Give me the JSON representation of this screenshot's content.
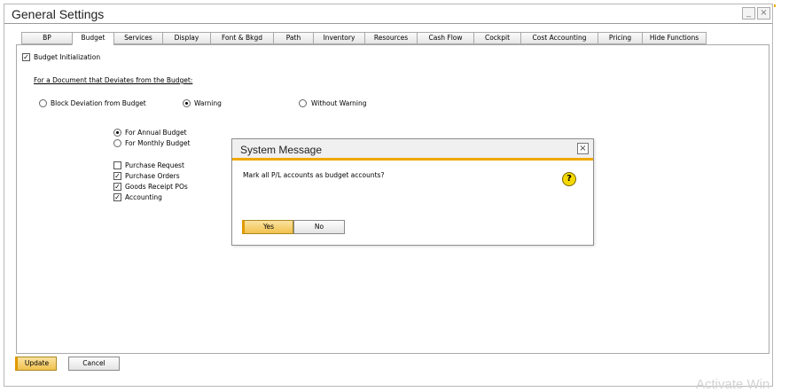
{
  "window": {
    "title": "General Settings",
    "minimize": "_",
    "close": "×"
  },
  "tabs": [
    {
      "label": "BP",
      "active": false
    },
    {
      "label": "Budget",
      "active": true
    },
    {
      "label": "Services",
      "active": false
    },
    {
      "label": "Display",
      "active": false
    },
    {
      "label": "Font & Bkgd",
      "active": false
    },
    {
      "label": "Path",
      "active": false
    },
    {
      "label": "Inventory",
      "active": false
    },
    {
      "label": "Resources",
      "active": false
    },
    {
      "label": "Cash Flow",
      "active": false
    },
    {
      "label": "Cockpit",
      "active": false
    },
    {
      "label": "Cost Accounting",
      "active": false
    },
    {
      "label": "Pricing",
      "active": false
    },
    {
      "label": "Hide Functions",
      "active": false
    }
  ],
  "budget": {
    "init": {
      "label": "Budget Initialization",
      "checked": true
    },
    "deviation_heading": "For a Document that Deviates from the Budget:",
    "deviation_options": [
      {
        "label": "Block Deviation from Budget",
        "selected": false
      },
      {
        "label": "Warning",
        "selected": true
      },
      {
        "label": "Without Warning",
        "selected": false
      }
    ],
    "budget_type": [
      {
        "label": "For Annual Budget",
        "selected": true
      },
      {
        "label": "For Monthly Budget",
        "selected": false
      }
    ],
    "documents": [
      {
        "label": "Purchase Request",
        "checked": false
      },
      {
        "label": "Purchase Orders",
        "checked": true
      },
      {
        "label": "Goods Receipt POs",
        "checked": true
      },
      {
        "label": "Accounting",
        "checked": true
      }
    ]
  },
  "footer": {
    "update_label": "Update",
    "cancel_label": "Cancel"
  },
  "dialog": {
    "title": "System Message",
    "message": "Mark all P/L accounts as budget accounts?",
    "help_glyph": "?",
    "close_glyph": "×",
    "yes_label": "Yes",
    "no_label": "No"
  },
  "watermark": "Activate Win",
  "colors": {
    "accent": "#f0a800",
    "primary_button": "#f1c14e"
  }
}
